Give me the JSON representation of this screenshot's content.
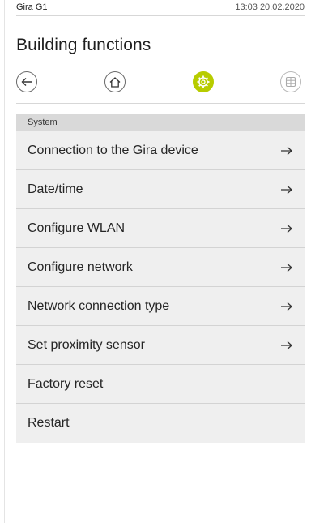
{
  "status": {
    "device": "Gira G1",
    "datetime": "13:03 20.02.2020"
  },
  "title": "Building functions",
  "nav": [
    {
      "id": "back",
      "icon": "back-arrow-icon"
    },
    {
      "id": "home",
      "icon": "home-icon"
    },
    {
      "id": "settings",
      "icon": "gear-icon",
      "active": true
    },
    {
      "id": "grid",
      "icon": "grid-icon",
      "disabled": true
    }
  ],
  "section": "System",
  "items": [
    {
      "label": "Connection to the Gira device",
      "arrow": true
    },
    {
      "label": "Date/time",
      "arrow": true
    },
    {
      "label": "Configure WLAN",
      "arrow": true
    },
    {
      "label": "Configure network",
      "arrow": true
    },
    {
      "label": "Network connection type",
      "arrow": true
    },
    {
      "label": "Set proximity sensor",
      "arrow": true
    },
    {
      "label": "Factory reset",
      "arrow": false
    },
    {
      "label": "Restart",
      "arrow": false
    }
  ],
  "colors": {
    "accent": "#b7cc00",
    "list_bg": "#efefef",
    "header_bg": "#d9d9d9"
  }
}
